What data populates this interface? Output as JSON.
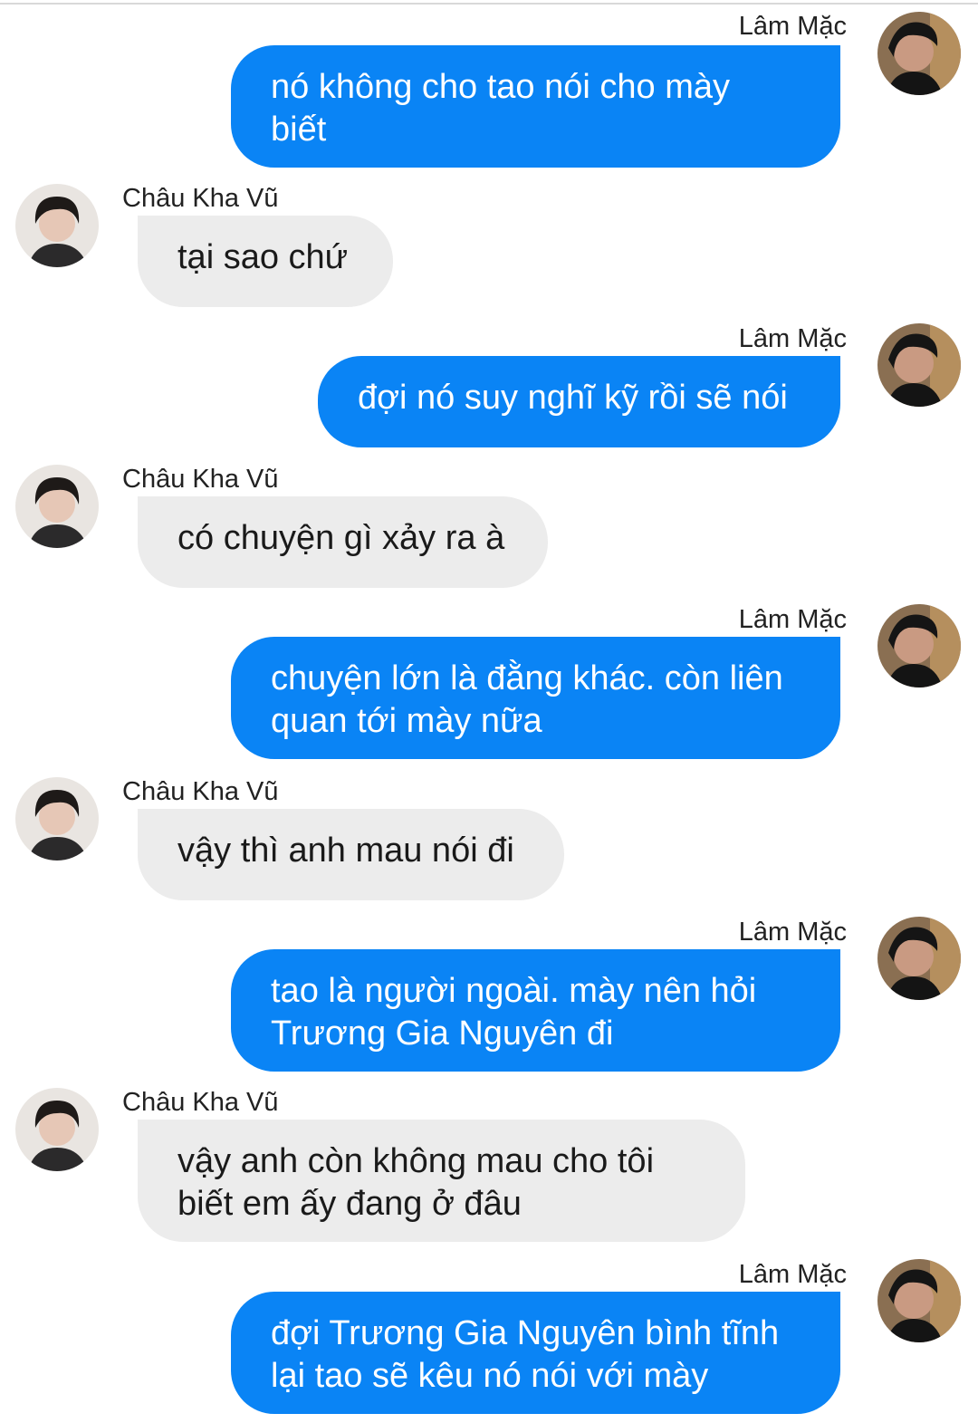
{
  "conversation": {
    "participants": {
      "me": {
        "name": "Lâm Mặc",
        "avatar_icon": "user-avatar-icon"
      },
      "other": {
        "name": "Châu Kha Vũ",
        "avatar_icon": "user-avatar-icon"
      }
    },
    "colors": {
      "outgoing_bubble": "#0a84f5",
      "incoming_bubble": "#ececec",
      "outgoing_text": "#ffffff",
      "incoming_text": "#1a1a1a"
    },
    "messages": [
      {
        "sender": "Lâm Mặc",
        "direction": "outgoing",
        "lines": [
          "nó không cho tao nói cho mày",
          "biết"
        ]
      },
      {
        "sender": "Châu Kha Vũ",
        "direction": "incoming",
        "lines": [
          "tại sao chứ"
        ]
      },
      {
        "sender": "Lâm Mặc",
        "direction": "outgoing",
        "lines": [
          "đợi nó suy nghĩ kỹ rồi sẽ nói"
        ]
      },
      {
        "sender": "Châu Kha Vũ",
        "direction": "incoming",
        "lines": [
          "có chuyện gì xảy ra à"
        ]
      },
      {
        "sender": "Lâm Mặc",
        "direction": "outgoing",
        "lines": [
          "chuyện lớn là đằng khác. còn liên",
          "quan tới mày nữa"
        ]
      },
      {
        "sender": "Châu Kha Vũ",
        "direction": "incoming",
        "lines": [
          "vậy thì anh mau nói đi"
        ]
      },
      {
        "sender": "Lâm Mặc",
        "direction": "outgoing",
        "lines": [
          "tao là người ngoài. mày nên hỏi",
          "Trương Gia Nguyên đi"
        ]
      },
      {
        "sender": "Châu Kha Vũ",
        "direction": "incoming",
        "lines": [
          "vậy anh còn không mau cho tôi",
          "biết em ấy đang ở đâu"
        ]
      },
      {
        "sender": "Lâm Mặc",
        "direction": "outgoing",
        "lines": [
          "đợi Trương Gia Nguyên bình tĩnh",
          "lại tao sẽ kêu nó nói với mày"
        ]
      }
    ]
  }
}
